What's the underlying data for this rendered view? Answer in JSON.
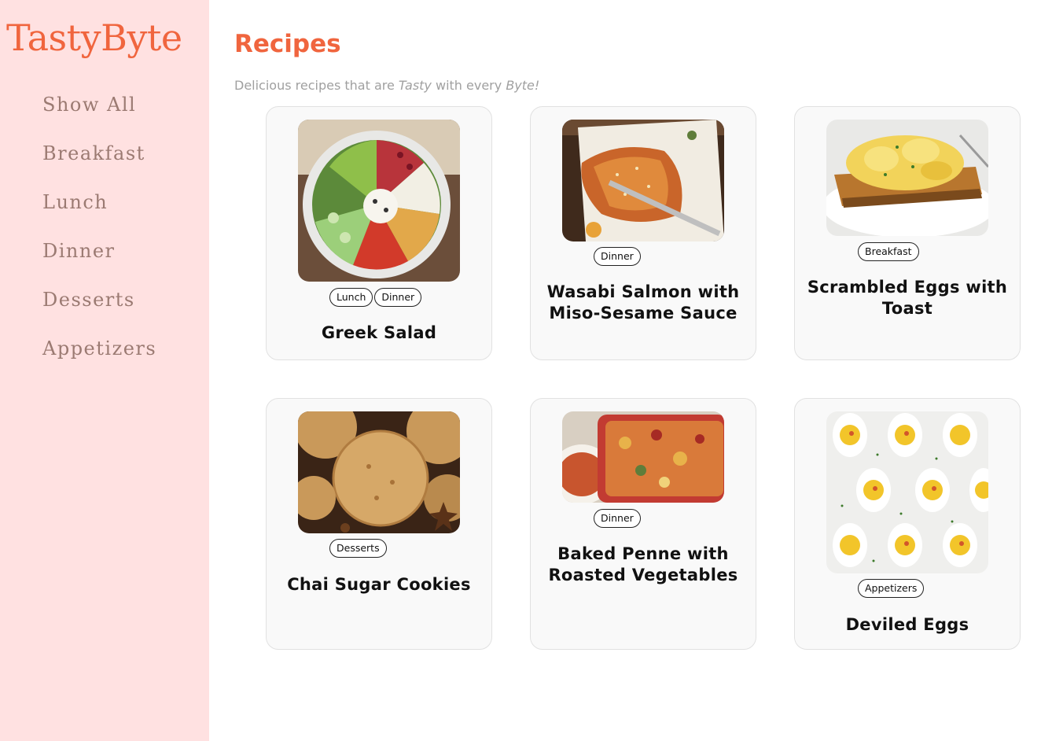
{
  "app": {
    "brand": "TastyByte"
  },
  "sidebar": {
    "items": [
      {
        "label": "Show All"
      },
      {
        "label": "Breakfast"
      },
      {
        "label": "Lunch"
      },
      {
        "label": "Dinner"
      },
      {
        "label": "Desserts"
      },
      {
        "label": "Appetizers"
      }
    ]
  },
  "header": {
    "title": "Recipes",
    "subtitle_pre": "Delicious recipes that are ",
    "subtitle_em1": "Tasty",
    "subtitle_mid": " with every ",
    "subtitle_em2": "Byte!"
  },
  "recipes": [
    {
      "title": "Greek Salad",
      "tags": [
        "Lunch",
        "Dinner"
      ],
      "image": "greek-salad-photo"
    },
    {
      "title": "Wasabi Salmon with Miso-Sesame Sauce",
      "tags": [
        "Dinner"
      ],
      "image": "wasabi-salmon-photo"
    },
    {
      "title": "Scrambled Eggs with Toast",
      "tags": [
        "Breakfast"
      ],
      "image": "scrambled-eggs-photo"
    },
    {
      "title": "Chai Sugar Cookies",
      "tags": [
        "Desserts"
      ],
      "image": "chai-cookies-photo"
    },
    {
      "title": "Baked Penne with Roasted Vegetables",
      "tags": [
        "Dinner"
      ],
      "image": "baked-penne-photo"
    },
    {
      "title": "Deviled Eggs",
      "tags": [
        "Appetizers"
      ],
      "image": "deviled-eggs-photo"
    }
  ],
  "colors": {
    "accent": "#f0653e",
    "sidebar_bg": "#ffe1e1",
    "nav_text": "#9b7a72",
    "subtitle_text": "#a0a0a0",
    "card_bg": "#f9f9f9"
  }
}
